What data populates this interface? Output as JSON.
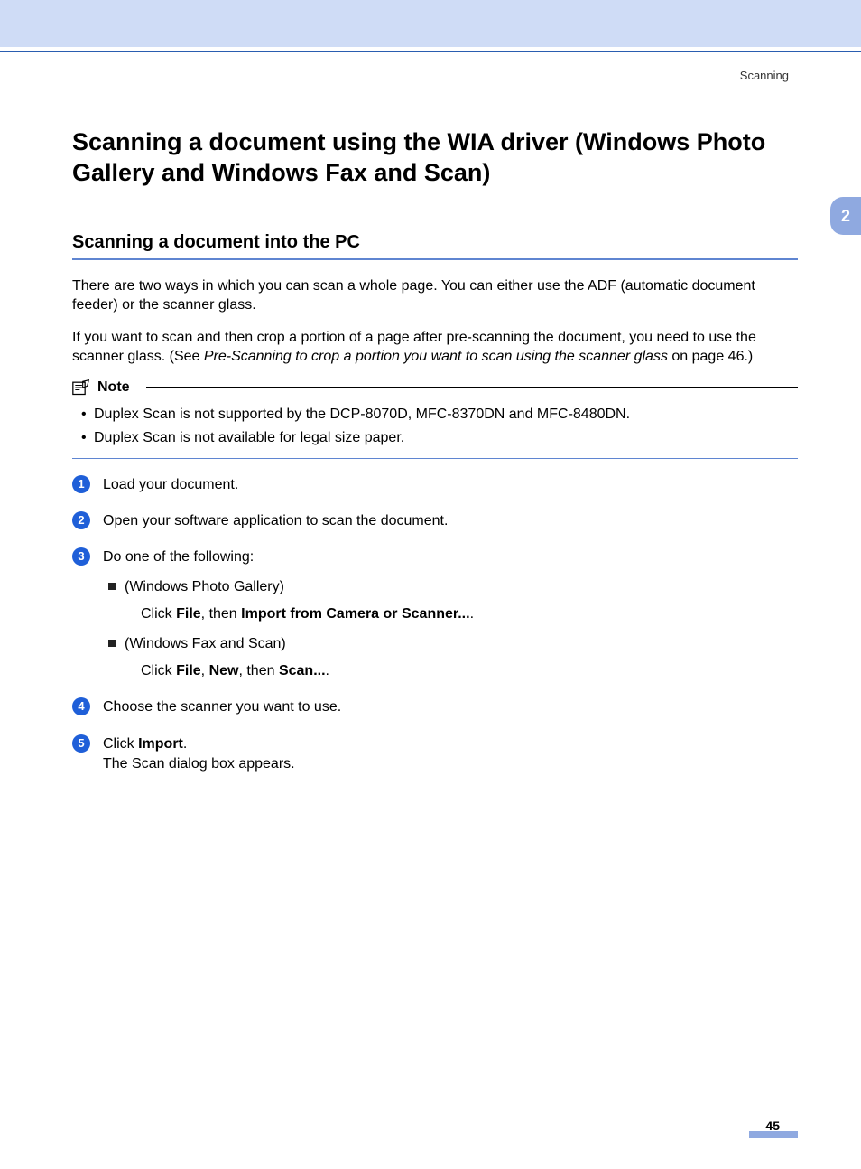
{
  "header": {
    "running_head": "Scanning",
    "chapter_tab": "2"
  },
  "title": "Scanning a document using the WIA driver (Windows Photo Gallery and Windows Fax and Scan)",
  "section_heading": "Scanning a document into the PC",
  "intro": {
    "p1": "There are two ways in which you can scan a whole page. You can either use the ADF (automatic document feeder) or the scanner glass.",
    "p2_pre": "If you want to scan and then crop a portion of a page after pre-scanning the document, you need to use the scanner glass. (See ",
    "p2_link": "Pre-Scanning to crop a portion you want to scan using the scanner glass",
    "p2_post": " on page 46.)"
  },
  "note": {
    "label": "Note",
    "items": [
      "Duplex Scan is not supported by the DCP-8070D, MFC-8370DN and MFC-8480DN.",
      "Duplex Scan is not available for legal size paper."
    ]
  },
  "steps": {
    "s1": "Load your document.",
    "s2": "Open your software application to scan the document.",
    "s3_lead": "Do one of the following:",
    "s3_a_label": "(Windows Photo Gallery)",
    "s3_a_click": "Click ",
    "s3_a_b1": "File",
    "s3_a_mid": ", then ",
    "s3_a_b2": "Import from Camera or Scanner...",
    "s3_a_end": ".",
    "s3_b_label": "(Windows Fax and Scan)",
    "s3_b_click": "Click ",
    "s3_b_b1": "File",
    "s3_b_mid1": ", ",
    "s3_b_b2": "New",
    "s3_b_mid2": ", then ",
    "s3_b_b3": "Scan...",
    "s3_b_end": ".",
    "s4": "Choose the scanner you want to use.",
    "s5_click": "Click ",
    "s5_b": "Import",
    "s5_end": ".",
    "s5_line2": "The Scan dialog box appears."
  },
  "footer": {
    "page_number": "45"
  }
}
